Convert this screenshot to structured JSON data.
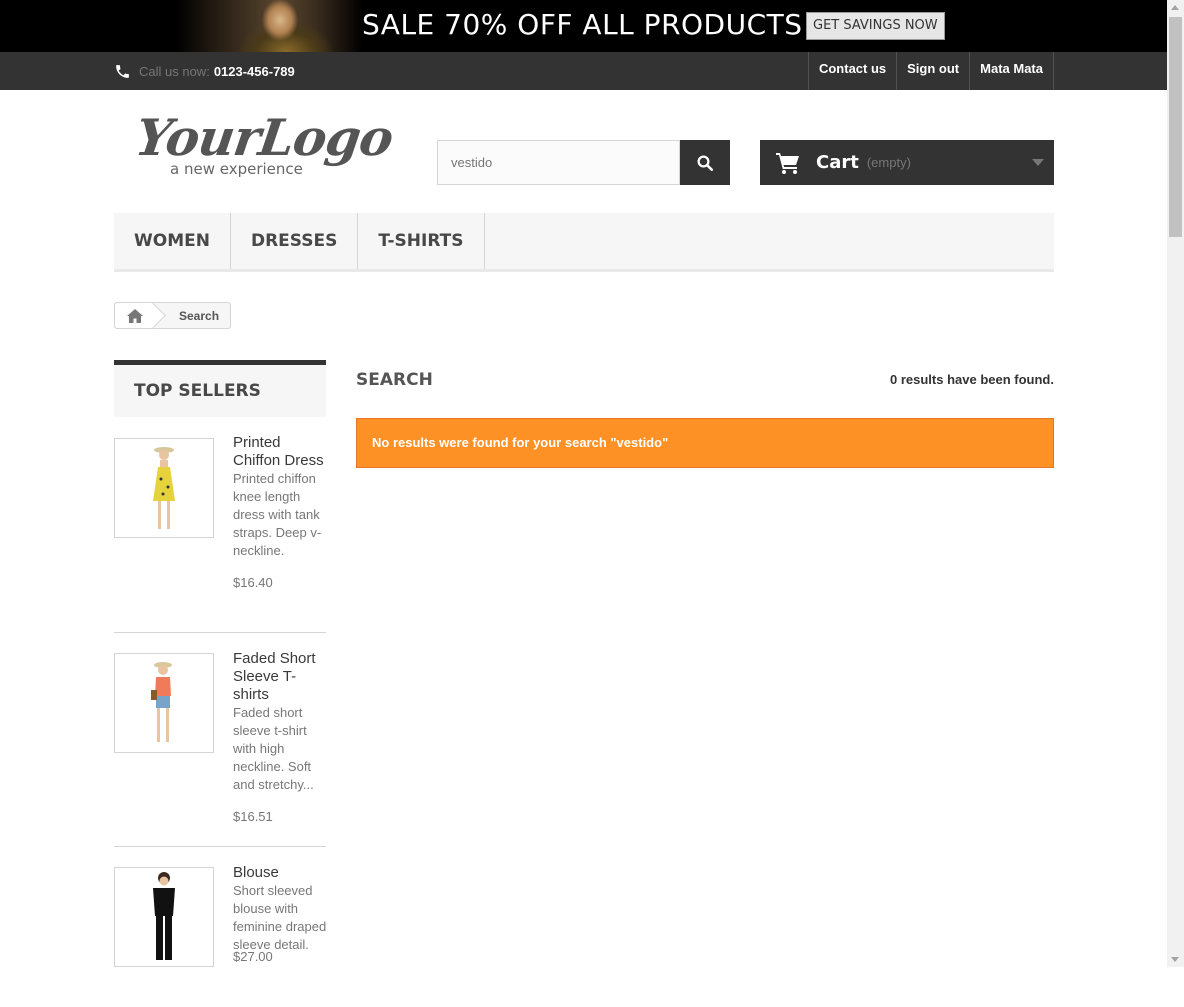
{
  "banner": {
    "text": "SALE 70% OFF ALL PRODUCTS",
    "button": "GET SAVINGS NOW"
  },
  "topnav": {
    "call_label": "Call us now:",
    "phone": "0123-456-789",
    "links": [
      "Contact us",
      "Sign out",
      "Mata Mata"
    ]
  },
  "logo": {
    "main": "YourLogo",
    "sub": "a new experience"
  },
  "search": {
    "value": "vestido"
  },
  "cart": {
    "title": "Cart",
    "status": "(empty)"
  },
  "menu": [
    "WOMEN",
    "DRESSES",
    "T-SHIRTS"
  ],
  "breadcrumb": {
    "current": "Search"
  },
  "sidebar": {
    "title": "TOP SELLERS",
    "products": [
      {
        "name": "Printed Chiffon Dress",
        "desc": "Printed chiffon knee length dress with tank straps. Deep v-neckline.",
        "price": "$16.40"
      },
      {
        "name": "Faded Short Sleeve T-shirts",
        "desc": "Faded short sleeve t-shirt with high neckline. Soft and stretchy...",
        "price": "$16.51"
      },
      {
        "name": "Blouse",
        "desc": "Short sleeved blouse with feminine draped sleeve detail.",
        "price": "$27.00"
      }
    ]
  },
  "main": {
    "heading": "SEARCH",
    "results": "0 results have been found.",
    "alert": "No results were found for your search \"vestido\""
  },
  "colors": {
    "alert": "#fe9126",
    "dark": "#333333"
  },
  "icons": [
    "phone-icon",
    "search-icon",
    "cart-icon",
    "home-icon",
    "caret-down-icon"
  ]
}
